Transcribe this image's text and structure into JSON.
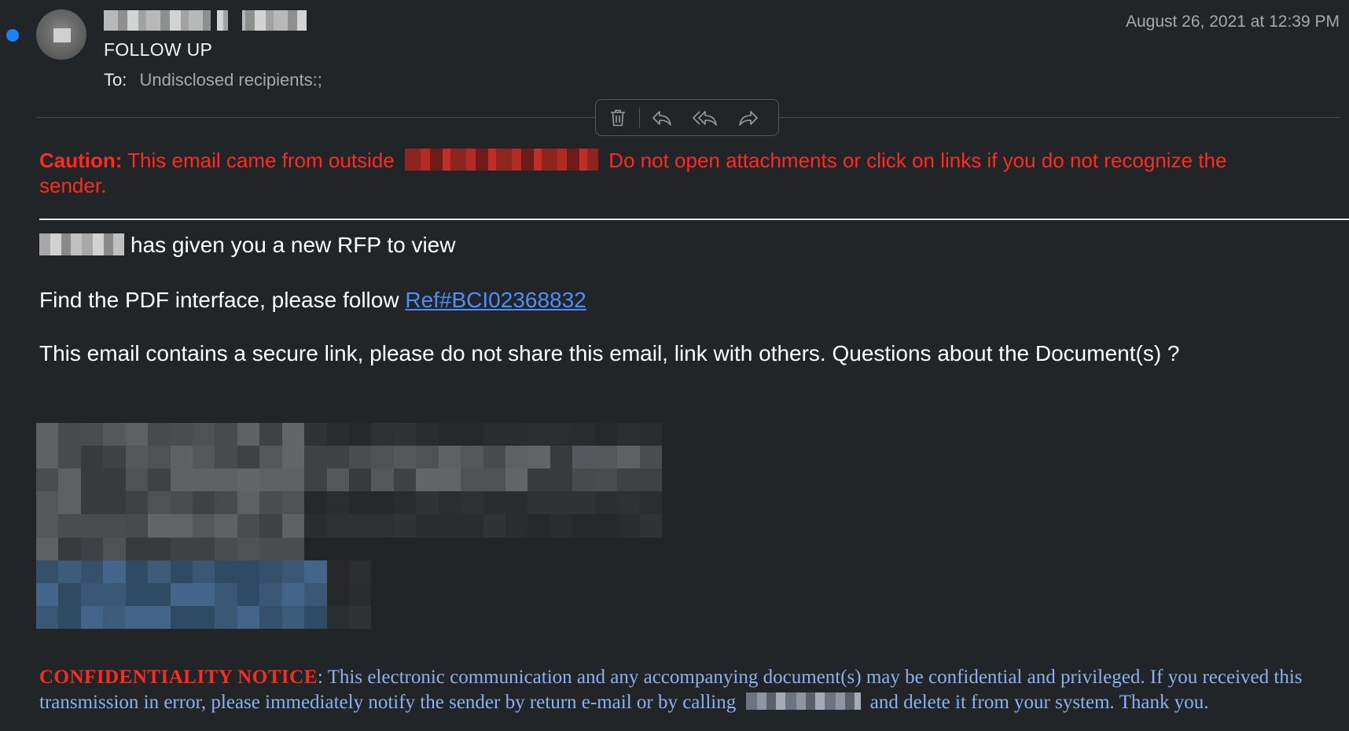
{
  "message": {
    "subject": "FOLLOW UP",
    "to_label": "To:",
    "to_value": "Undisclosed recipients:;",
    "date": "August 26, 2021 at 12:39 PM",
    "unread": true
  },
  "toolbar": {
    "buttons": [
      {
        "name": "trash",
        "icon": "trash-icon"
      },
      {
        "name": "reply",
        "icon": "reply-icon"
      },
      {
        "name": "reply-all",
        "icon": "reply-all-icon"
      },
      {
        "name": "forward",
        "icon": "forward-icon"
      }
    ]
  },
  "caution": {
    "label": "Caution:",
    "text_before": " This email came from outside ",
    "text_after": " Do not open attachments or click on links if you do not recognize the sender."
  },
  "body": {
    "rfp_text": "has given you a new RFP to view",
    "pdf_text": "Find the PDF interface, please follow ",
    "pdf_link": "Ref#BCI02368832",
    "secure_text": "This email contains a secure link, please do not share this email, link with others. Questions about the Document(s) ?"
  },
  "footer": {
    "notice_title": "CONFIDENTIALITY NOTICE",
    "notice_colon": ":",
    "notice_text_before": "  This electronic communication and any accompanying document(s) may be confidential and privileged.  If you received this transmission in error, please immediately notify the sender by return e-mail or by calling ",
    "notice_text_after": " and delete it from your system.  Thank you."
  },
  "colors": {
    "background": "#222527",
    "caution": "#ff2a20",
    "link": "#4f8ef7",
    "notice_text": "#8bb2ee",
    "unread_dot": "#1c80fb"
  }
}
